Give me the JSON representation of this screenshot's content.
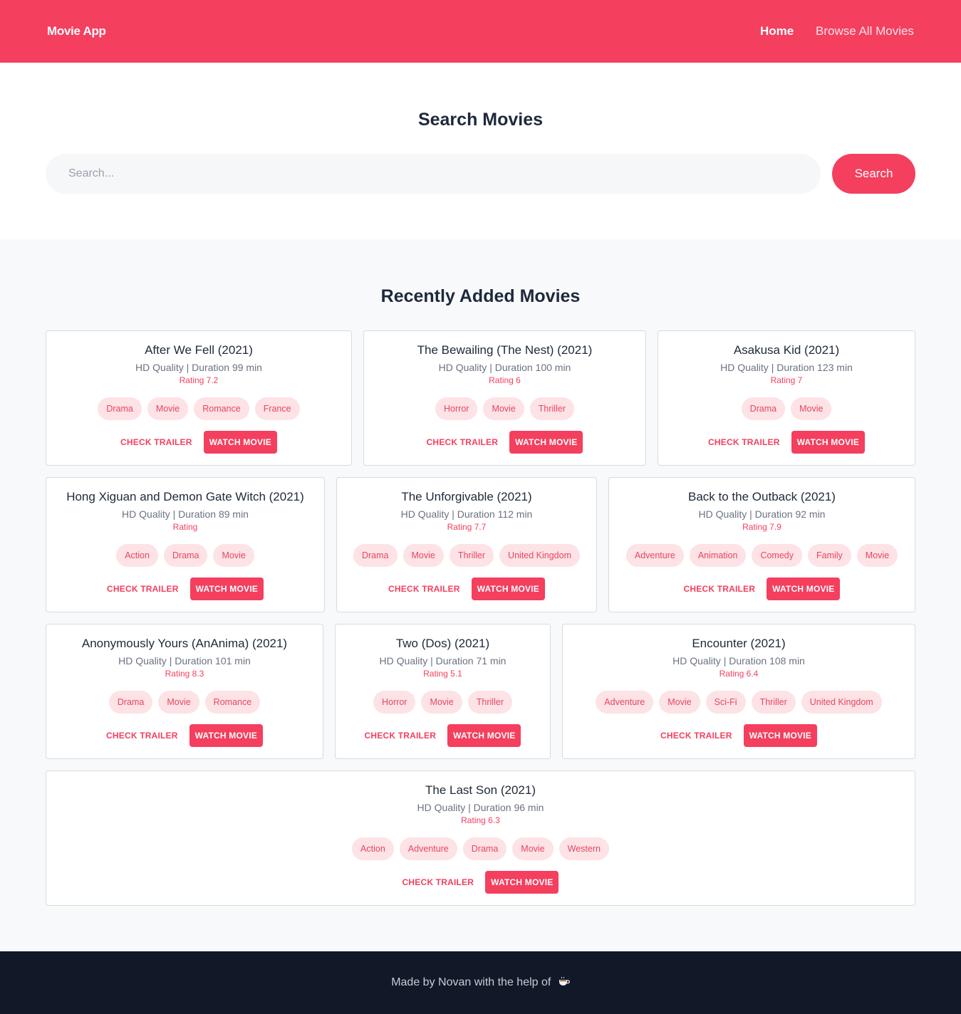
{
  "navbar": {
    "brand": "Movie App",
    "links": [
      {
        "label": "Home"
      },
      {
        "label": "Browse All Movies"
      }
    ]
  },
  "search": {
    "title": "Search Movies",
    "placeholder": "Search...",
    "value": "",
    "button_label": "Search"
  },
  "recent": {
    "title": "Recently Added Movies"
  },
  "movies": [
    {
      "title": "After We Fell (2021)",
      "quality": "HD Quality",
      "duration": "Duration 99 min",
      "rating": "Rating 7.2",
      "tags": [
        "Drama",
        "Movie",
        "Romance",
        "France"
      ],
      "trailer_label": "CHECK TRAILER",
      "watch_label": "WATCH MOVIE"
    },
    {
      "title": "The Bewailing (The Nest) (2021)",
      "quality": "HD Quality",
      "duration": "Duration 100 min",
      "rating": "Rating 6",
      "tags": [
        "Horror",
        "Movie",
        "Thriller"
      ],
      "trailer_label": "CHECK TRAILER",
      "watch_label": "WATCH MOVIE"
    },
    {
      "title": "Asakusa Kid (2021)",
      "quality": "HD Quality",
      "duration": "Duration 123 min",
      "rating": "Rating 7",
      "tags": [
        "Drama",
        "Movie"
      ],
      "trailer_label": "CHECK TRAILER",
      "watch_label": "WATCH MOVIE"
    },
    {
      "title": "Hong Xiguan and Demon Gate Witch (2021)",
      "quality": "HD Quality",
      "duration": "Duration 89 min",
      "rating": "Rating",
      "tags": [
        "Action",
        "Drama",
        "Movie"
      ],
      "trailer_label": "CHECK TRAILER",
      "watch_label": "WATCH MOVIE"
    },
    {
      "title": "The Unforgivable (2021)",
      "quality": "HD Quality",
      "duration": "Duration 112 min",
      "rating": "Rating 7.7",
      "tags": [
        "Drama",
        "Movie",
        "Thriller",
        "United Kingdom"
      ],
      "trailer_label": "CHECK TRAILER",
      "watch_label": "WATCH MOVIE"
    },
    {
      "title": "Back to the Outback (2021)",
      "quality": "HD Quality",
      "duration": "Duration 92 min",
      "rating": "Rating 7.9",
      "tags": [
        "Adventure",
        "Animation",
        "Comedy",
        "Family",
        "Movie"
      ],
      "trailer_label": "CHECK TRAILER",
      "watch_label": "WATCH MOVIE"
    },
    {
      "title": "Anonymously Yours (AnAnima) (2021)",
      "quality": "HD Quality",
      "duration": "Duration 101 min",
      "rating": "Rating 8.3",
      "tags": [
        "Drama",
        "Movie",
        "Romance"
      ],
      "trailer_label": "CHECK TRAILER",
      "watch_label": "WATCH MOVIE"
    },
    {
      "title": "Two (Dos) (2021)",
      "quality": "HD Quality",
      "duration": "Duration 71 min",
      "rating": "Rating 5.1",
      "tags": [
        "Horror",
        "Movie",
        "Thriller"
      ],
      "trailer_label": "CHECK TRAILER",
      "watch_label": "WATCH MOVIE"
    },
    {
      "title": "Encounter (2021)",
      "quality": "HD Quality",
      "duration": "Duration 108 min",
      "rating": "Rating 6.4",
      "tags": [
        "Adventure",
        "Movie",
        "Sci-Fi",
        "Thriller",
        "United Kingdom"
      ],
      "trailer_label": "CHECK TRAILER",
      "watch_label": "WATCH MOVIE"
    },
    {
      "title": "The Last Son (2021)",
      "quality": "HD Quality",
      "duration": "Duration 96 min",
      "rating": "Rating 6.3",
      "tags": [
        "Action",
        "Adventure",
        "Drama",
        "Movie",
        "Western"
      ],
      "trailer_label": "CHECK TRAILER",
      "watch_label": "WATCH MOVIE"
    }
  ],
  "footer": {
    "text": "Made by Novan with the help of",
    "icon": "coffee-icon"
  },
  "colors": {
    "accent": "#f43f5e",
    "tag_bg": "#fde2e6",
    "footer_bg": "#111827"
  }
}
